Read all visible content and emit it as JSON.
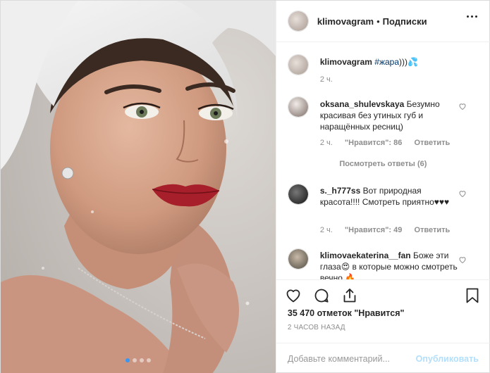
{
  "header": {
    "username": "klimovagram",
    "separator": "•",
    "follow_label": "Подписки"
  },
  "caption": {
    "username": "klimovagram",
    "hashtag": "#жара",
    "text": ")))💦",
    "time": "2 ч."
  },
  "comments": [
    {
      "username": "oksana_shulevskaya",
      "text": "Безумно красивая без утиных губ и наращённых ресниц)",
      "time": "2 ч.",
      "likes": "\"Нравится\": 86",
      "reply": "Ответить",
      "view_replies": "Посмотреть ответы (6)"
    },
    {
      "username": "s._h777ss",
      "text": "Вот природная красота!!!! Смотреть приятно♥♥♥",
      "time": "2 ч.",
      "likes": "\"Нравится\": 49",
      "reply": "Ответить"
    },
    {
      "username": "klimovaekaterina__fan",
      "text": "Боже эти глаза😍 в которые можно смотреть вечно 🔥"
    }
  ],
  "actions": {
    "like_icon": "heart-icon",
    "comment_icon": "comment-icon",
    "share_icon": "share-icon",
    "save_icon": "bookmark-icon",
    "likes_count": "35 470 отметок \"Нравится\"",
    "posted": "2 ЧАСОВ НАЗАД"
  },
  "add_comment": {
    "placeholder": "Добавьте комментарий...",
    "publish": "Опубликовать"
  },
  "carousel": {
    "total": 4,
    "active": 1
  },
  "colors": {
    "link": "#003569",
    "accent": "#3897f0",
    "publish_disabled": "#b2dffc",
    "muted": "#8e8e8e"
  }
}
